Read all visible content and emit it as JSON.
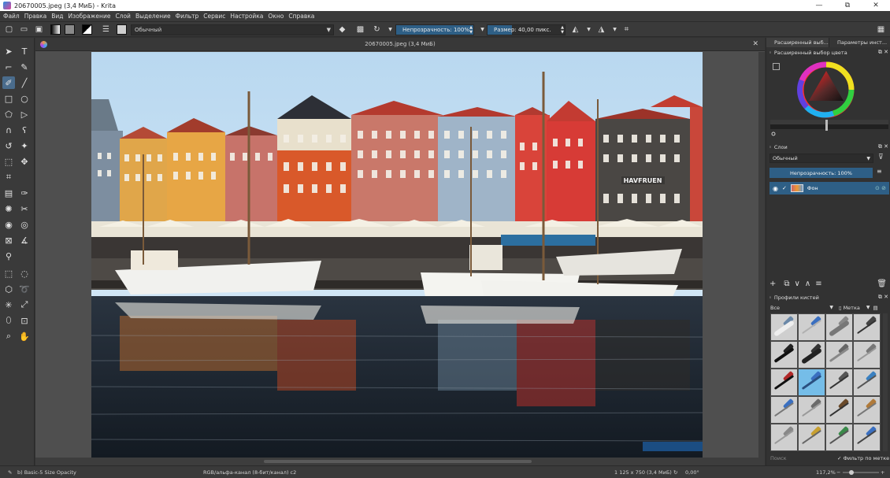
{
  "window": {
    "title": "20670005.jpeg (3,4 МиБ)  - Krita",
    "controls": [
      "—",
      "⧉",
      "✕"
    ]
  },
  "menu": [
    "Файл",
    "Правка",
    "Вид",
    "Изображение",
    "Слой",
    "Выделение",
    "Фильтр",
    "Сервис",
    "Настройка",
    "Окно",
    "Справка"
  ],
  "toolbar": {
    "blend_mode": "Обычный",
    "opacity_label": "Непрозрачность: 100%",
    "opacity_value": 100,
    "size_label": "Размер: 40,00 пикс.",
    "size_value": 40
  },
  "document": {
    "tab_title": "20670005.jpeg (3,4 МиБ)"
  },
  "dock": {
    "tabs": [
      "Расширенный выб...",
      "Параметры инст..."
    ],
    "color_selector_title": "Расширенный выбор цвета",
    "layers_title": "Слои",
    "layers_blend": "Обычный",
    "layers_opacity": "Непрозрачность: 100%",
    "layers": [
      {
        "name": "Фон",
        "visible": true
      }
    ],
    "brushes_title": "Профили кистей",
    "brush_filter": "Все",
    "tag_label": "Метка",
    "search_placeholder": "Поиск",
    "tag_filter_label": "Фильтр по метке"
  },
  "status": {
    "brush": "b) Basic-5 Size Opacity",
    "color_space": "RGB/альфа-канал (8-бит/канал)  c2",
    "dimensions": "1 125 x 750 (3,4 МиБ)",
    "rotation": "0,00°",
    "zoom": "117,2%"
  },
  "colors": {
    "accent": "#2e5f86",
    "panel": "#3a3a3a",
    "canvas_bg": "#4f4f4f"
  }
}
